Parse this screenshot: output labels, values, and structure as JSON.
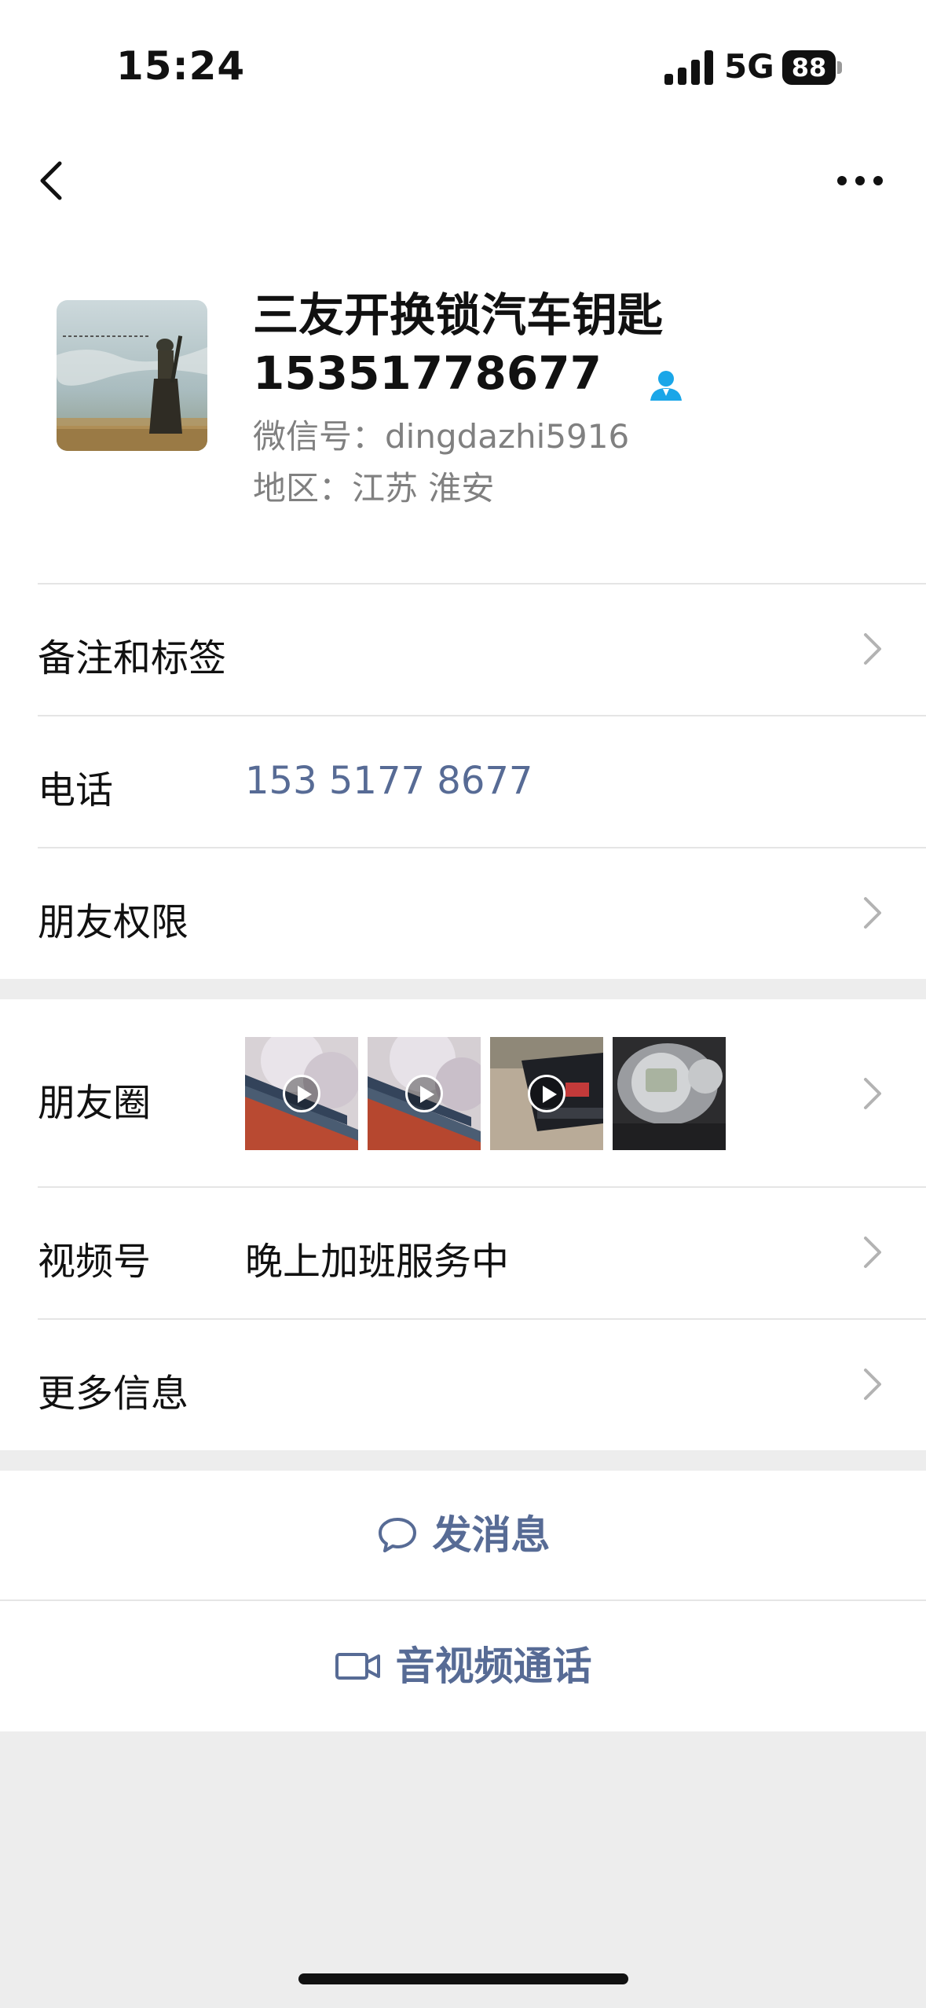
{
  "status": {
    "time": "15:24",
    "network": "5G",
    "battery": "88"
  },
  "profile": {
    "name_line1": "三友开换锁汽车钥匙",
    "name_line2": "15351778677",
    "wechat_id": "微信号：dingdazhi5916",
    "region": "地区：江苏 淮安"
  },
  "rows": {
    "remarks": {
      "label": "备注和标签"
    },
    "phone": {
      "label": "电话",
      "value": "153 5177 8677"
    },
    "permissions": {
      "label": "朋友权限"
    },
    "moments": {
      "label": "朋友圈"
    },
    "channels": {
      "label": "视频号",
      "value": "晚上加班服务中"
    },
    "more_info": {
      "label": "更多信息"
    }
  },
  "actions": {
    "message": "发消息",
    "call": "音视频通话"
  },
  "colors": {
    "link": "#576b95",
    "secondary": "#808080",
    "background": "#ededed",
    "contact_icon": "#1aa6e8"
  },
  "icons": [
    "back-icon",
    "more-icon",
    "contact-icon",
    "chevron-right-icon",
    "chat-bubble-icon",
    "video-camera-icon",
    "play-icon"
  ]
}
